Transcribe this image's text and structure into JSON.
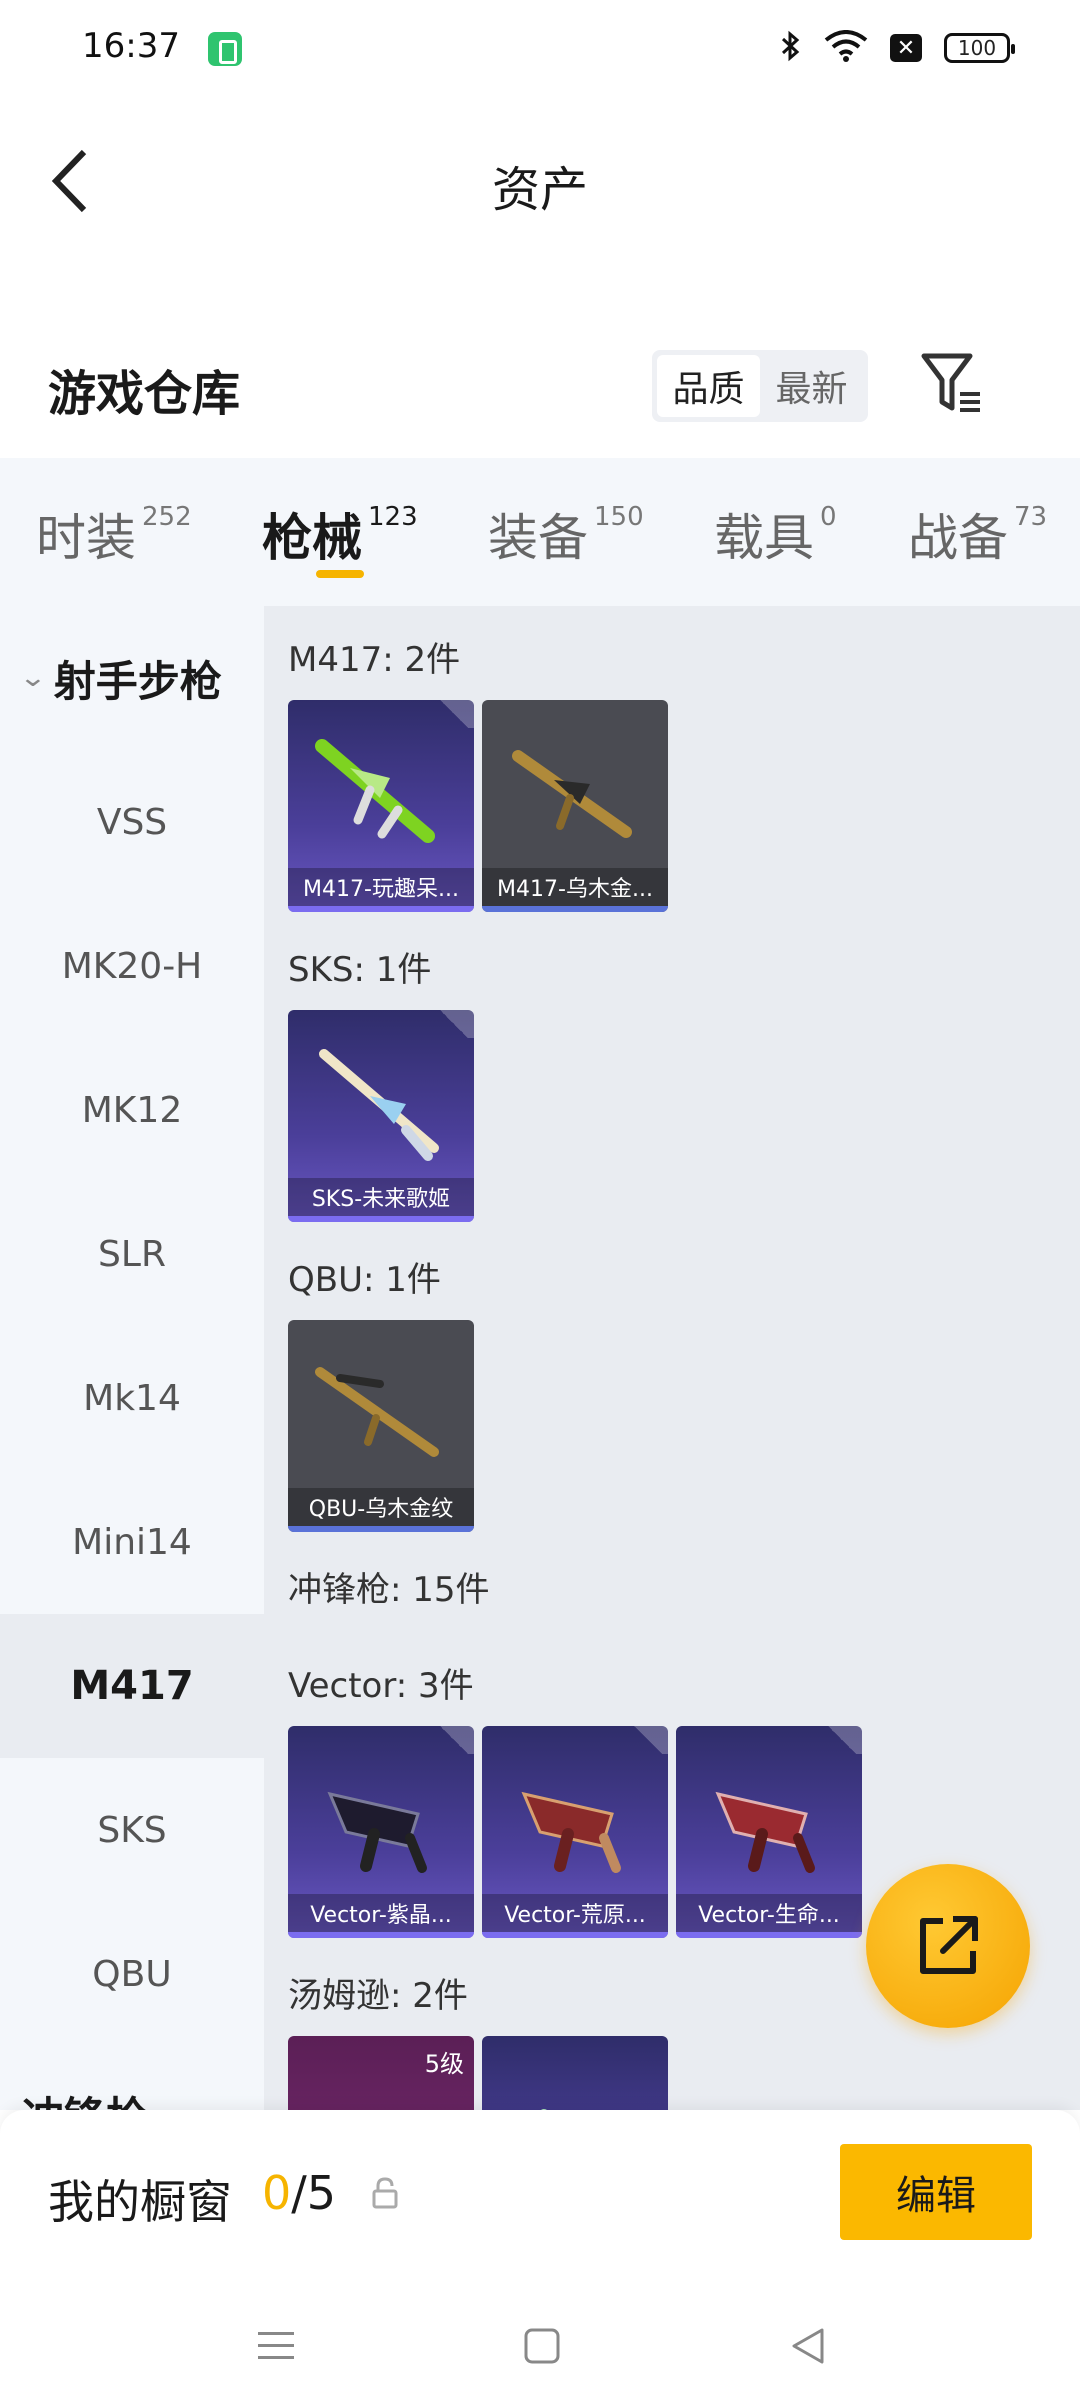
{
  "status": {
    "time": "16:37",
    "battery": "100"
  },
  "header": {
    "title": "资产"
  },
  "warehouse": {
    "title": "游戏仓库",
    "sort_options": [
      "品质",
      "最新"
    ],
    "active_sort": "品质"
  },
  "tabs": [
    {
      "label": "时装",
      "count": "252"
    },
    {
      "label": "枪械",
      "count": "123"
    },
    {
      "label": "装备",
      "count": "150"
    },
    {
      "label": "载具",
      "count": "0"
    },
    {
      "label": "战备",
      "count": "73"
    }
  ],
  "sidebar": {
    "group": "射手步枪",
    "items": [
      "VSS",
      "MK20-H",
      "MK12",
      "SLR",
      "Mk14",
      "Mini14",
      "M417",
      "SKS",
      "QBU"
    ],
    "active": "M417",
    "next_group": "冲锋枪"
  },
  "content": {
    "sections": [
      {
        "title": "M417: 2件",
        "cards": [
          "M417-玩趣呆...",
          "M417-乌木金..."
        ]
      },
      {
        "title": "SKS: 1件",
        "cards": [
          "SKS-未来歌姬"
        ]
      },
      {
        "title": "QBU: 1件",
        "cards": [
          "QBU-乌木金纹"
        ]
      },
      {
        "title": "冲锋枪: 15件"
      },
      {
        "title": "Vector: 3件",
        "cards": [
          "Vector-紫晶...",
          "Vector-荒原...",
          "Vector-生命..."
        ]
      },
      {
        "title": "汤姆逊: 2件",
        "badge": "5级"
      }
    ]
  },
  "showcase": {
    "label": "我的橱窗",
    "current": "0",
    "total": "/5",
    "edit": "编辑"
  },
  "colors": {
    "accent": "#f6b400",
    "edit_button": "#fbb800",
    "card_purple": "#4b3f9a",
    "card_grey": "#4a4b52"
  }
}
